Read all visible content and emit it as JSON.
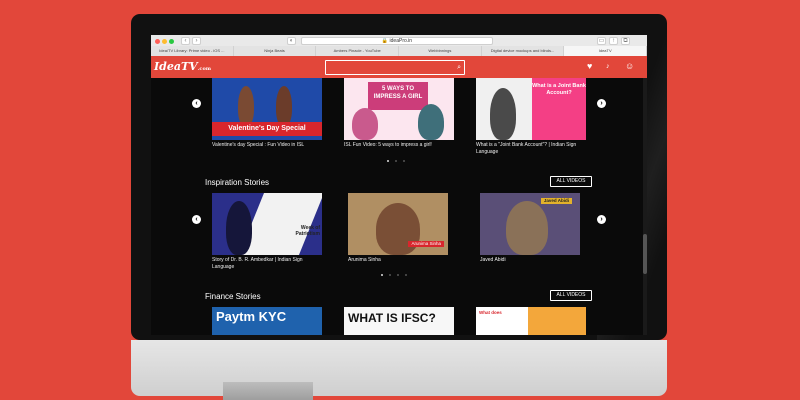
{
  "browser": {
    "address": "🔒 ideaPro.in",
    "tabs": [
      {
        "label": "Idea/TV Library: Prime video - iOS ...",
        "active": false
      },
      {
        "label": "Ninja Beats",
        "active": false
      },
      {
        "label": "Ambers Pinacle - YouTube",
        "active": false
      },
      {
        "label": "Webbinnings",
        "active": false
      },
      {
        "label": "Digital device mockups and blinds...",
        "active": false
      },
      {
        "label": "IdeaTV",
        "active": true
      }
    ]
  },
  "header": {
    "logo": "IdeaTV",
    "logo_sub": ".com"
  },
  "sections": [
    {
      "title": "",
      "cards": [
        {
          "title": "Valentine's day Special : Fun Video in ISL",
          "thumb_text": "Valentine's Day Special"
        },
        {
          "title": "ISL Fun Video: 5 ways to impress a girl!",
          "thumb_text": "5 WAYS TO IMPRESS A GIRL"
        },
        {
          "title": "What is a \"Joint Bank Account\"? | Indian Sign Language",
          "thumb_text": "What is a Joint Bank Account?"
        }
      ]
    },
    {
      "title": "Inspiration Stories",
      "all_videos": "ALL VIDEOS",
      "cards": [
        {
          "title": "Story of Dr. B. R. Ambedkar | Indian Sign Language",
          "thumb_text": "Week of Patriotism"
        },
        {
          "title": "Arunima Sinha",
          "thumb_text": "Arunima Sinha"
        },
        {
          "title": "Javed Abidi",
          "thumb_text": "Javed Abidi"
        }
      ]
    },
    {
      "title": "Finance Stories",
      "all_videos": "ALL VIDEOS",
      "cards": [
        {
          "title": "",
          "thumb_text": "Paytm KYC"
        },
        {
          "title": "",
          "thumb_text": "WHAT IS IFSC?"
        },
        {
          "title": "",
          "thumb_text": "What does"
        }
      ]
    }
  ],
  "icons": {
    "prev": "‹",
    "next": "›",
    "search": "⌕",
    "heart": "♥",
    "bell": "🔔",
    "user": "☺"
  }
}
